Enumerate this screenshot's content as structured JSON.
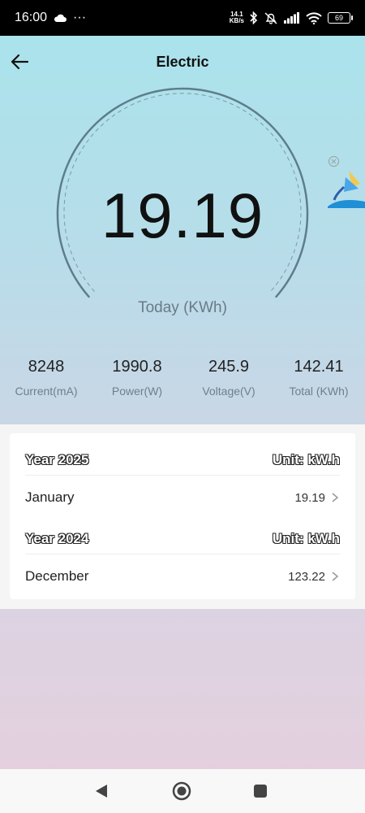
{
  "status_bar": {
    "time": "16:00",
    "cloud_icon": "cloud-icon",
    "more_indicator": "···",
    "net_speed_value": "14.1",
    "net_speed_unit": "KB/s",
    "battery": "69"
  },
  "header": {
    "title": "Electric",
    "back_icon": "arrow-left-icon"
  },
  "gauge": {
    "value": "19.19",
    "label": "Today (KWh)"
  },
  "stats": [
    {
      "value": "8248",
      "label": "Current(mA)"
    },
    {
      "value": "1990.8",
      "label": "Power(W)"
    },
    {
      "value": "245.9",
      "label": "Voltage(V)"
    },
    {
      "value": "142.41",
      "label": "Total (KWh)"
    }
  ],
  "history": [
    {
      "year_title": "Year 2025",
      "unit": "Unit: kW.h",
      "months": [
        {
          "name": "January",
          "value": "19.19"
        }
      ]
    },
    {
      "year_title": "Year 2024",
      "unit": "Unit: kW.h",
      "months": [
        {
          "name": "December",
          "value": "123.22"
        }
      ]
    }
  ],
  "nav": {
    "back_icon": "triangle-back-icon",
    "home_icon": "circle-home-icon",
    "recents_icon": "square-recents-icon"
  },
  "colors": {
    "status_bar_bg": "#000000",
    "gauge_arc": "#5e7d8c",
    "gradient_top": "#a8e4ec",
    "gradient_bottom": "#e6cfdc"
  }
}
